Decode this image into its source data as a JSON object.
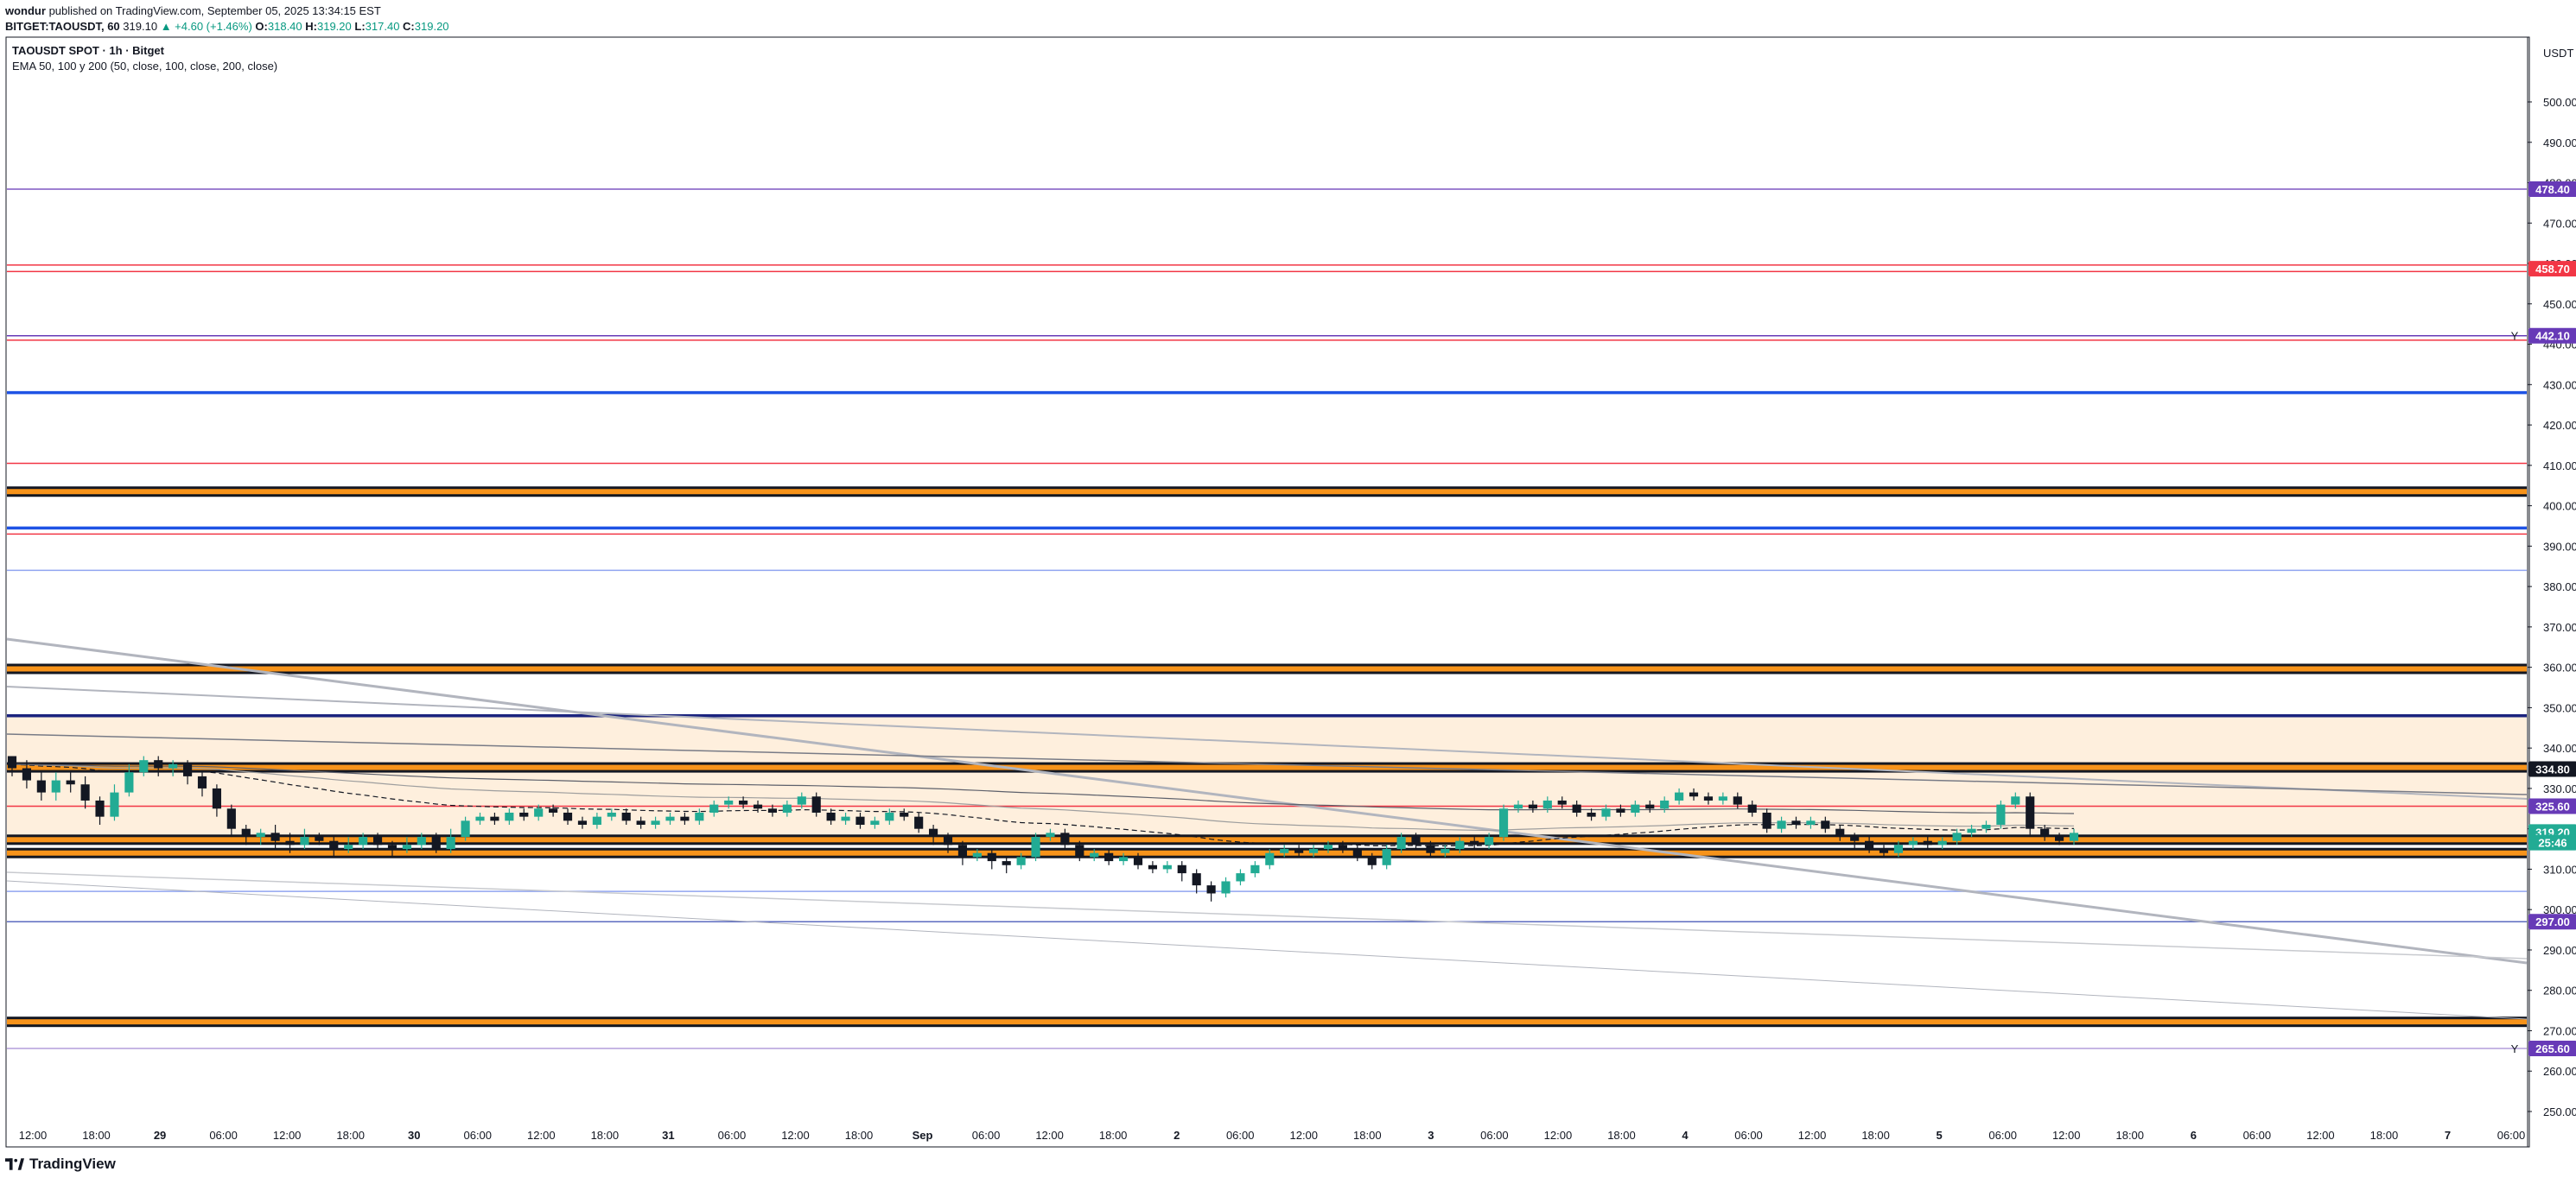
{
  "header": {
    "author": "wondur",
    "published": "published on TradingView.com, September 05, 2025 13:34:15 EST"
  },
  "ohlc": {
    "symbol": "BITGET:TAOUSDT, 60",
    "last": "319.10",
    "change": "▲ +4.60 (+1.46%)",
    "o_label": "O:",
    "o": "318.40",
    "h_label": "H:",
    "h": "319.20",
    "l_label": "L:",
    "l": "317.40",
    "c_label": "C:",
    "c": "319.20"
  },
  "legend": {
    "title": "TAOUSDT SPOT · 1h · Bitget",
    "indicator": "EMA 50, 100 y 200 (50, close, 100, close, 200, close)"
  },
  "axis": {
    "currency": "USDT"
  },
  "footer": {
    "brand": "TradingView"
  },
  "colors": {
    "up": "#22ab94",
    "down": "#131722",
    "orange": "#f7931a",
    "blue": "#1e53e5",
    "red": "#f23645",
    "purple": "#673ab7",
    "zone": "#fde9d2"
  },
  "chart_data": {
    "type": "candlestick",
    "title": "TAOUSDT SPOT · 1h · Bitget",
    "ylim": [
      245,
      510
    ],
    "y_ticks": [
      "250.00",
      "260.00",
      "270.00",
      "280.00",
      "290.00",
      "300.00",
      "310.00",
      "320.00",
      "330.00",
      "340.00",
      "350.00",
      "360.00",
      "370.00",
      "380.00",
      "390.00",
      "400.00",
      "410.00",
      "420.00",
      "430.00",
      "440.00",
      "450.00",
      "460.00",
      "470.00",
      "480.00",
      "490.00",
      "500.00"
    ],
    "x_ticks": [
      "12:00",
      "18:00",
      "29",
      "06:00",
      "12:00",
      "18:00",
      "30",
      "06:00",
      "12:00",
      "18:00",
      "31",
      "06:00",
      "12:00",
      "18:00",
      "Sep",
      "06:00",
      "12:00",
      "18:00",
      "2",
      "06:00",
      "12:00",
      "18:00",
      "3",
      "06:00",
      "12:00",
      "18:00",
      "4",
      "06:00",
      "12:00",
      "18:00",
      "5",
      "06:00",
      "12:00",
      "18:00",
      "6",
      "06:00",
      "12:00",
      "18:00",
      "7",
      "06:00"
    ],
    "price_tags": [
      {
        "label": "478.40",
        "value": 478.4,
        "color": "#673ab7"
      },
      {
        "label": "458.70",
        "value": 458.7,
        "color": "#f23645"
      },
      {
        "label": "442.10",
        "value": 442.1,
        "color": "#673ab7",
        "marker": "Y"
      },
      {
        "label": "334.80",
        "value": 334.8,
        "color": "#131722"
      },
      {
        "label": "325.60",
        "value": 325.6,
        "color": "#673ab7"
      },
      {
        "label": "319.20",
        "value": 319.2,
        "color": "#22ab94"
      },
      {
        "label": "25:46",
        "value": 316.6,
        "color": "#22ab94"
      },
      {
        "label": "297.00",
        "value": 297.0,
        "color": "#673ab7"
      },
      {
        "label": "265.60",
        "value": 265.6,
        "color": "#673ab7",
        "marker": "Y"
      }
    ],
    "horizontal_lines": [
      {
        "value": 478.4,
        "color": "#7e57c2"
      },
      {
        "value": 459.6,
        "color": "#f23645"
      },
      {
        "value": 458.0,
        "color": "#f23645"
      },
      {
        "value": 442.1,
        "color": "#673ab7"
      },
      {
        "value": 441.0,
        "color": "#f23645"
      },
      {
        "value": 428.0,
        "color": "#1e53e5"
      },
      {
        "value": 410.5,
        "color": "#f23645"
      },
      {
        "value": 394.5,
        "color": "#1e53e5"
      },
      {
        "value": 393.0,
        "color": "#f23645"
      },
      {
        "value": 384.0,
        "color": "#90a4f0"
      },
      {
        "value": 348.0,
        "color": "#1a237e"
      },
      {
        "value": 325.6,
        "color": "#f23645"
      },
      {
        "value": 304.5,
        "color": "#90a4f0"
      },
      {
        "value": 297.0,
        "color": "#5c6bc0"
      },
      {
        "value": 265.6,
        "color": "#b39ddb"
      }
    ],
    "orange_bands": [
      403.5,
      359.6,
      335.2,
      317.3,
      314.0,
      272.2
    ],
    "zone": {
      "from": 348.0,
      "to": 318.0
    },
    "candles": [
      [
        338,
        335,
        338,
        333
      ],
      [
        335,
        332,
        337,
        330
      ],
      [
        332,
        329,
        334,
        327
      ],
      [
        329,
        332,
        334,
        327
      ],
      [
        332,
        331,
        334,
        329
      ],
      [
        331,
        327,
        333,
        325
      ],
      [
        327,
        323,
        328,
        321
      ],
      [
        323,
        329,
        331,
        322
      ],
      [
        329,
        334,
        336,
        328
      ],
      [
        334,
        337,
        338,
        333
      ],
      [
        337,
        335,
        338,
        333
      ],
      [
        335,
        336,
        337,
        333
      ],
      [
        336,
        333,
        337,
        331
      ],
      [
        333,
        330,
        334,
        328
      ],
      [
        330,
        325,
        331,
        323
      ],
      [
        325,
        320,
        326,
        318
      ],
      [
        320,
        318,
        321,
        316
      ],
      [
        318,
        319,
        320,
        316
      ],
      [
        319,
        317,
        321,
        315
      ],
      [
        317,
        316,
        319,
        314
      ],
      [
        316,
        318,
        320,
        315
      ],
      [
        318,
        317,
        319,
        316
      ],
      [
        317,
        315,
        318,
        313
      ],
      [
        315,
        316,
        318,
        314
      ],
      [
        316,
        318,
        319,
        315
      ],
      [
        318,
        316,
        319,
        315
      ],
      [
        316,
        315,
        317,
        313
      ],
      [
        315,
        316,
        318,
        314
      ],
      [
        316,
        318,
        319,
        315
      ],
      [
        318,
        315,
        319,
        314
      ],
      [
        315,
        318,
        320,
        314
      ],
      [
        318,
        322,
        323,
        317
      ],
      [
        322,
        323,
        324,
        321
      ],
      [
        323,
        322,
        324,
        321
      ],
      [
        322,
        324,
        325,
        321
      ],
      [
        324,
        323,
        325,
        322
      ],
      [
        323,
        325,
        326,
        322
      ],
      [
        325,
        324,
        326,
        323
      ],
      [
        324,
        322,
        325,
        321
      ],
      [
        322,
        321,
        323,
        320
      ],
      [
        321,
        323,
        324,
        320
      ],
      [
        323,
        324,
        325,
        322
      ],
      [
        324,
        322,
        325,
        321
      ],
      [
        322,
        321,
        323,
        320
      ],
      [
        321,
        322,
        323,
        320
      ],
      [
        322,
        323,
        324,
        321
      ],
      [
        323,
        322,
        324,
        321
      ],
      [
        322,
        324,
        325,
        321
      ],
      [
        324,
        326,
        327,
        323
      ],
      [
        326,
        327,
        328,
        325
      ],
      [
        327,
        326,
        328,
        325
      ],
      [
        326,
        325,
        327,
        324
      ],
      [
        325,
        324,
        326,
        323
      ],
      [
        324,
        326,
        327,
        323
      ],
      [
        326,
        328,
        329,
        325
      ],
      [
        328,
        324,
        329,
        323
      ],
      [
        324,
        322,
        325,
        321
      ],
      [
        322,
        323,
        324,
        321
      ],
      [
        323,
        321,
        324,
        320
      ],
      [
        321,
        322,
        323,
        320
      ],
      [
        322,
        324,
        325,
        321
      ],
      [
        324,
        323,
        325,
        322
      ],
      [
        323,
        320,
        324,
        319
      ],
      [
        320,
        318,
        321,
        316
      ],
      [
        318,
        316,
        319,
        314
      ],
      [
        316,
        313,
        317,
        311
      ],
      [
        313,
        314,
        315,
        312
      ],
      [
        314,
        312,
        315,
        310
      ],
      [
        312,
        311,
        313,
        309
      ],
      [
        311,
        313,
        314,
        310
      ],
      [
        313,
        318,
        319,
        312
      ],
      [
        318,
        319,
        320,
        317
      ],
      [
        319,
        316,
        320,
        315
      ],
      [
        316,
        313,
        317,
        312
      ],
      [
        313,
        314,
        315,
        312
      ],
      [
        314,
        312,
        315,
        311
      ],
      [
        312,
        313,
        314,
        311
      ],
      [
        313,
        311,
        314,
        310
      ],
      [
        311,
        310,
        312,
        309
      ],
      [
        310,
        311,
        312,
        309
      ],
      [
        311,
        309,
        312,
        307
      ],
      [
        309,
        306,
        310,
        304
      ],
      [
        306,
        304,
        307,
        302
      ],
      [
        304,
        307,
        308,
        303
      ],
      [
        307,
        309,
        310,
        306
      ],
      [
        309,
        311,
        312,
        308
      ],
      [
        311,
        314,
        315,
        310
      ],
      [
        314,
        315,
        316,
        313
      ],
      [
        315,
        314,
        316,
        313
      ],
      [
        314,
        315,
        316,
        313
      ],
      [
        315,
        316,
        317,
        314
      ],
      [
        316,
        315,
        317,
        314
      ],
      [
        315,
        313,
        316,
        312
      ],
      [
        313,
        311,
        314,
        310
      ],
      [
        311,
        315,
        316,
        310
      ],
      [
        315,
        318,
        319,
        314
      ],
      [
        318,
        316,
        319,
        315
      ],
      [
        316,
        314,
        317,
        313
      ],
      [
        314,
        315,
        316,
        313
      ],
      [
        315,
        317,
        318,
        314
      ],
      [
        317,
        316,
        318,
        315
      ],
      [
        316,
        318,
        319,
        315
      ],
      [
        318,
        325,
        326,
        317
      ],
      [
        325,
        326,
        327,
        324
      ],
      [
        326,
        325,
        327,
        324
      ],
      [
        325,
        327,
        328,
        324
      ],
      [
        327,
        326,
        328,
        325
      ],
      [
        326,
        324,
        327,
        323
      ],
      [
        324,
        323,
        325,
        322
      ],
      [
        323,
        325,
        326,
        322
      ],
      [
        325,
        324,
        326,
        323
      ],
      [
        324,
        326,
        327,
        323
      ],
      [
        326,
        325,
        327,
        324
      ],
      [
        325,
        327,
        328,
        324
      ],
      [
        327,
        329,
        330,
        326
      ],
      [
        329,
        328,
        330,
        327
      ],
      [
        328,
        327,
        329,
        326
      ],
      [
        327,
        328,
        329,
        326
      ],
      [
        328,
        326,
        329,
        325
      ],
      [
        326,
        324,
        327,
        323
      ],
      [
        324,
        320,
        325,
        319
      ],
      [
        320,
        322,
        323,
        319
      ],
      [
        322,
        321,
        323,
        320
      ],
      [
        321,
        322,
        323,
        320
      ],
      [
        322,
        320,
        323,
        319
      ],
      [
        320,
        318,
        321,
        317
      ],
      [
        318,
        317,
        319,
        315
      ],
      [
        317,
        315,
        318,
        314
      ],
      [
        315,
        314,
        316,
        313
      ],
      [
        314,
        316,
        317,
        313
      ],
      [
        316,
        317,
        318,
        315
      ],
      [
        317,
        316,
        318,
        315
      ],
      [
        316,
        317,
        318,
        315
      ],
      [
        317,
        319,
        320,
        316
      ],
      [
        319,
        320,
        321,
        318
      ],
      [
        320,
        321,
        322,
        319
      ],
      [
        321,
        326,
        327,
        320
      ],
      [
        326,
        328,
        329,
        325
      ],
      [
        328,
        320,
        329,
        318
      ],
      [
        320,
        318,
        321,
        317
      ],
      [
        318,
        317,
        319,
        316
      ],
      [
        317,
        319,
        320,
        316
      ]
    ]
  }
}
